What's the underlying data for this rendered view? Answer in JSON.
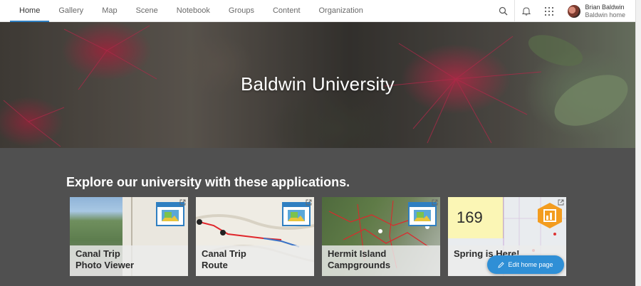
{
  "nav": {
    "items": [
      {
        "label": "Home",
        "active": true
      },
      {
        "label": "Gallery",
        "active": false
      },
      {
        "label": "Map",
        "active": false
      },
      {
        "label": "Scene",
        "active": false
      },
      {
        "label": "Notebook",
        "active": false
      },
      {
        "label": "Groups",
        "active": false
      },
      {
        "label": "Content",
        "active": false
      },
      {
        "label": "Organization",
        "active": false
      }
    ],
    "icons": [
      "search-icon",
      "bell-icon",
      "app-launcher-icon"
    ]
  },
  "user": {
    "name": "Brian Baldwin",
    "subtitle": "Baldwin home"
  },
  "hero": {
    "title": "Baldwin University"
  },
  "section": {
    "heading": "Explore our university with these applications."
  },
  "cards": [
    {
      "line1": "Canal Trip",
      "line2": "Photo Viewer",
      "badge": "web-app-icon"
    },
    {
      "line1": "Canal Trip",
      "line2": "Route",
      "badge": "web-app-icon"
    },
    {
      "line1": "Hermit Island",
      "line2": "Campgrounds",
      "badge": "web-app-icon"
    },
    {
      "line1": "Spring is Here!",
      "line2": "",
      "badge": "dashboard-icon",
      "thumb_number": "169"
    }
  ],
  "edit_button": {
    "label": "Edit home page"
  },
  "colors": {
    "accent": "#2f7fc1",
    "edit_button": "#2f8fd6",
    "section_bg": "#505050"
  }
}
